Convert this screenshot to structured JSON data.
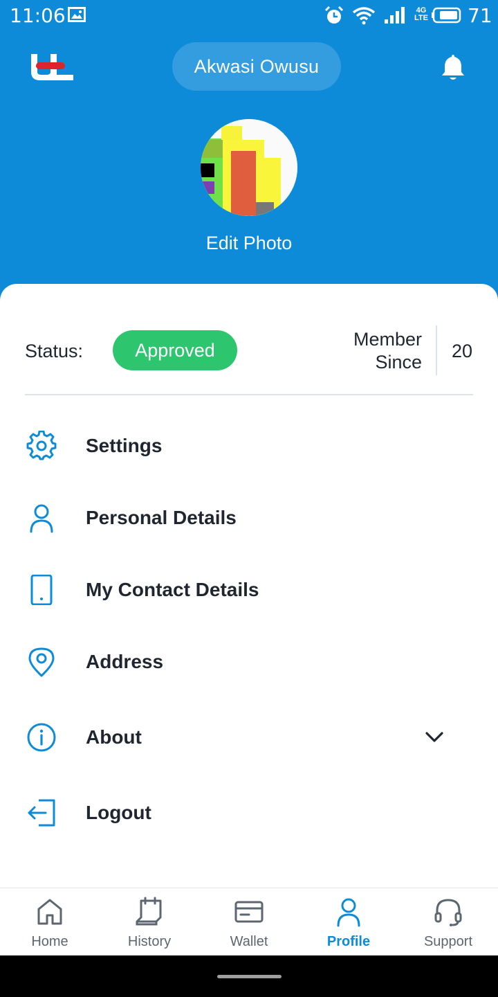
{
  "status_bar": {
    "time": "11:06",
    "network_top": "4G",
    "network_bottom": "LTE",
    "battery": "71"
  },
  "header": {
    "user_name": "Akwasi Owusu",
    "edit_photo": "Edit Photo"
  },
  "profile": {
    "status_label": "Status:",
    "status_value": "Approved",
    "member_since_label_line1": "Member",
    "member_since_label_line2": "Since",
    "member_since_value": "20"
  },
  "menu": {
    "items": [
      {
        "label": "Settings",
        "icon": "gear-icon"
      },
      {
        "label": "Personal Details",
        "icon": "user-icon"
      },
      {
        "label": "My Contact Details",
        "icon": "phone-icon"
      },
      {
        "label": "Address",
        "icon": "location-pin-icon"
      },
      {
        "label": "About",
        "icon": "info-icon"
      },
      {
        "label": "Logout",
        "icon": "logout-icon"
      }
    ]
  },
  "bottom_nav": {
    "items": [
      {
        "label": "Home",
        "icon": "home-icon"
      },
      {
        "label": "History",
        "icon": "history-icon"
      },
      {
        "label": "Wallet",
        "icon": "wallet-icon"
      },
      {
        "label": "Profile",
        "icon": "profile-icon"
      },
      {
        "label": "Support",
        "icon": "headset-icon"
      }
    ],
    "active": "Profile"
  },
  "colors": {
    "primary": "#0d8bd9",
    "success": "#2ec56f",
    "text": "#1f2630",
    "nav_inactive": "#5c6670"
  }
}
